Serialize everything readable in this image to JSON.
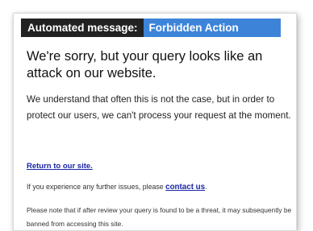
{
  "header": {
    "label": "Automated message:",
    "title": "Forbidden Action"
  },
  "heading": "We're sorry, but your query looks like an attack on our website.",
  "intro": "We understand that often this is not the case, but in order to protect our users, we can't process your request at the moment.",
  "return_link": "Return to our site.",
  "issues": {
    "text": "If you experience any further issues, please ",
    "link": "contact us",
    "suffix": "."
  },
  "note": "Please note that if after review your query is found to be a threat, it may subsequently be banned from accessing this site.",
  "colors": {
    "header_dark": "#222222",
    "header_accent": "#3d84d9",
    "link": "#1a24a8"
  }
}
